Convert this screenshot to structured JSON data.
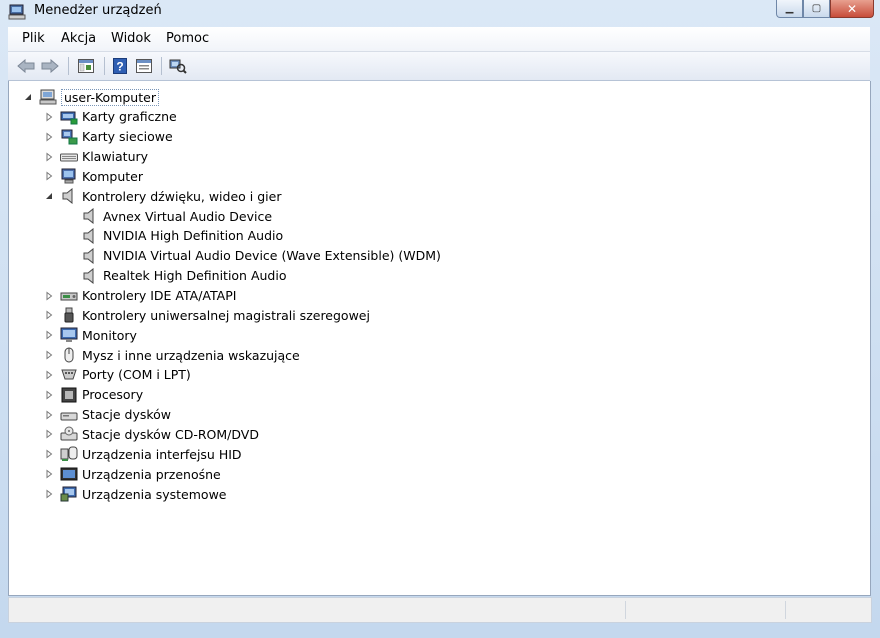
{
  "window": {
    "title": "Menedżer urządzeń"
  },
  "menu": {
    "items": [
      "Plik",
      "Akcja",
      "Widok",
      "Pomoc"
    ]
  },
  "toolbar": {
    "buttons": [
      "back-icon",
      "forward-icon",
      "show-hide-tree-icon",
      "help-icon",
      "properties-icon",
      "scan-hardware-icon"
    ]
  },
  "tree": {
    "root": "user-Komputer",
    "categories": [
      {
        "label": "Karty graficzne",
        "icon": "display-adapter-icon",
        "expanded": false
      },
      {
        "label": "Karty sieciowe",
        "icon": "network-adapter-icon",
        "expanded": false
      },
      {
        "label": "Klawiatury",
        "icon": "keyboard-icon",
        "expanded": false
      },
      {
        "label": "Komputer",
        "icon": "computer-icon",
        "expanded": false
      },
      {
        "label": "Kontrolery dźwięku, wideo i gier",
        "icon": "speaker-icon",
        "expanded": true,
        "children": [
          "Avnex Virtual Audio Device",
          "NVIDIA High Definition Audio",
          "NVIDIA Virtual Audio Device (Wave Extensible) (WDM)",
          "Realtek High Definition Audio"
        ]
      },
      {
        "label": "Kontrolery IDE ATA/ATAPI",
        "icon": "ide-controller-icon",
        "expanded": false
      },
      {
        "label": "Kontrolery uniwersalnej magistrali szeregowej",
        "icon": "usb-icon",
        "expanded": false
      },
      {
        "label": "Monitory",
        "icon": "monitor-icon",
        "expanded": false
      },
      {
        "label": "Mysz i inne urządzenia wskazujące",
        "icon": "mouse-icon",
        "expanded": false
      },
      {
        "label": "Porty (COM i LPT)",
        "icon": "port-icon",
        "expanded": false
      },
      {
        "label": "Procesory",
        "icon": "processor-icon",
        "expanded": false
      },
      {
        "label": "Stacje dysków",
        "icon": "disk-drive-icon",
        "expanded": false
      },
      {
        "label": "Stacje dysków CD-ROM/DVD",
        "icon": "cdrom-icon",
        "expanded": false
      },
      {
        "label": "Urządzenia interfejsu HID",
        "icon": "hid-icon",
        "expanded": false
      },
      {
        "label": "Urządzenia przenośne",
        "icon": "portable-device-icon",
        "expanded": false
      },
      {
        "label": "Urządzenia systemowe",
        "icon": "system-device-icon",
        "expanded": false
      }
    ]
  }
}
